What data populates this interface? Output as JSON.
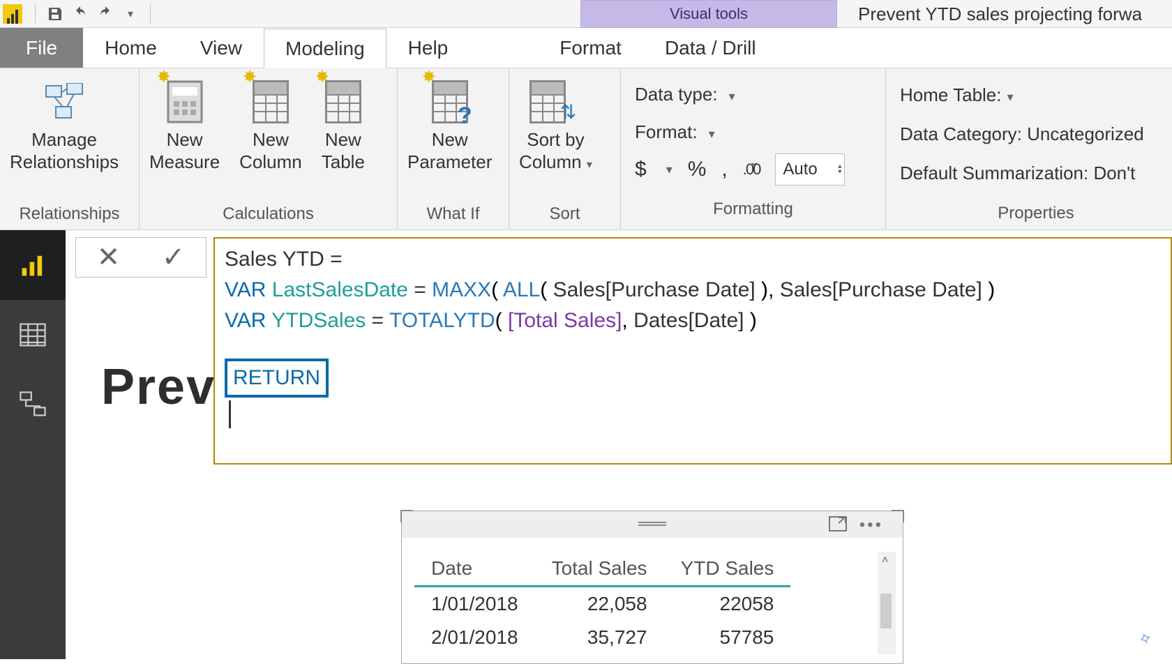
{
  "contextual_tab": "Visual tools",
  "doc_title": "Prevent YTD sales projecting forwa",
  "tabs": [
    "File",
    "Home",
    "View",
    "Modeling",
    "Help",
    "Format",
    "Data / Drill"
  ],
  "active_tab": "Modeling",
  "ribbon": {
    "relationships": {
      "btn": "Manage\nRelationships",
      "group": "Relationships"
    },
    "calculations": {
      "measure": "New\nMeasure",
      "column": "New\nColumn",
      "table": "New\nTable",
      "group": "Calculations"
    },
    "whatif": {
      "btn": "New\nParameter",
      "group": "What If"
    },
    "sort": {
      "btn": "Sort by\nColumn",
      "group": "Sort"
    },
    "formatting": {
      "datatype_label": "Data type:",
      "format_label": "Format:",
      "auto": "Auto",
      "currency": "$",
      "percent": "%",
      "comma": ",",
      "decimals": ".00",
      "group": "Formatting"
    },
    "properties": {
      "home_table": "Home Table:",
      "data_category": "Data Category: Uncategorized",
      "summarization": "Default Summarization: Don't",
      "group": "Properties"
    }
  },
  "formula": {
    "line1_name": "Sales YTD",
    "eq": " = ",
    "var": "VAR",
    "id1": "LastSalesDate",
    "fn_maxx": "MAXX",
    "fn_all": "ALL",
    "col_sales_date": "Sales[Purchase Date]",
    "id2": "YTDSales",
    "fn_totalytd": "TOTALYTD",
    "meas_total": "[Total Sales]",
    "col_dates": "Dates[Date]",
    "ret": "RETURN"
  },
  "background_text": "Prev",
  "table": {
    "headers": [
      "Date",
      "Total Sales",
      "YTD Sales"
    ],
    "rows": [
      [
        "1/01/2018",
        "22,058",
        "22058"
      ],
      [
        "2/01/2018",
        "35,727",
        "57785"
      ]
    ]
  }
}
